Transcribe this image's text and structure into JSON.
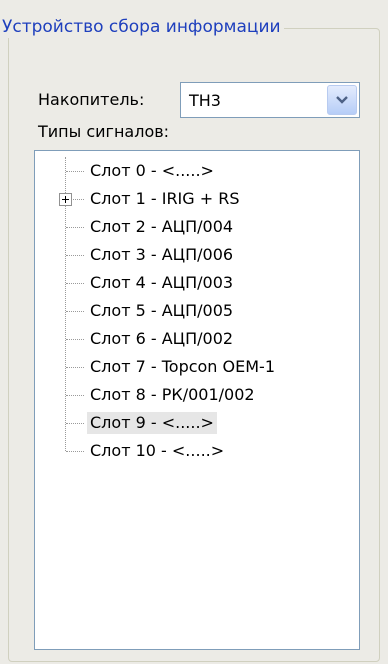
{
  "groupbox": {
    "title": "Устройство сбора информации"
  },
  "drive": {
    "label": "Накопитель:",
    "value": "ТН3",
    "dropdown_icon": "chevron-down-icon"
  },
  "signals": {
    "label": "Типы сигналов:",
    "items": [
      {
        "label": "Слот 0 - <.....>"
      },
      {
        "label": "Слот 1 - IRIG + RS",
        "expandable": true
      },
      {
        "label": "Слот 2 - АЦП/004"
      },
      {
        "label": "Слот 3 - АЦП/006"
      },
      {
        "label": "Слот 4 - АЦП/003"
      },
      {
        "label": "Слот 5 - АЦП/005"
      },
      {
        "label": "Слот 6 - АЦП/002"
      },
      {
        "label": "Слот 7 - Topcon OEM-1"
      },
      {
        "label": "Слот 8 - РК/001/002"
      },
      {
        "label": "Слот 9 - <.....>",
        "selected": true
      },
      {
        "label": "Слот 10 - <.....>"
      }
    ]
  }
}
